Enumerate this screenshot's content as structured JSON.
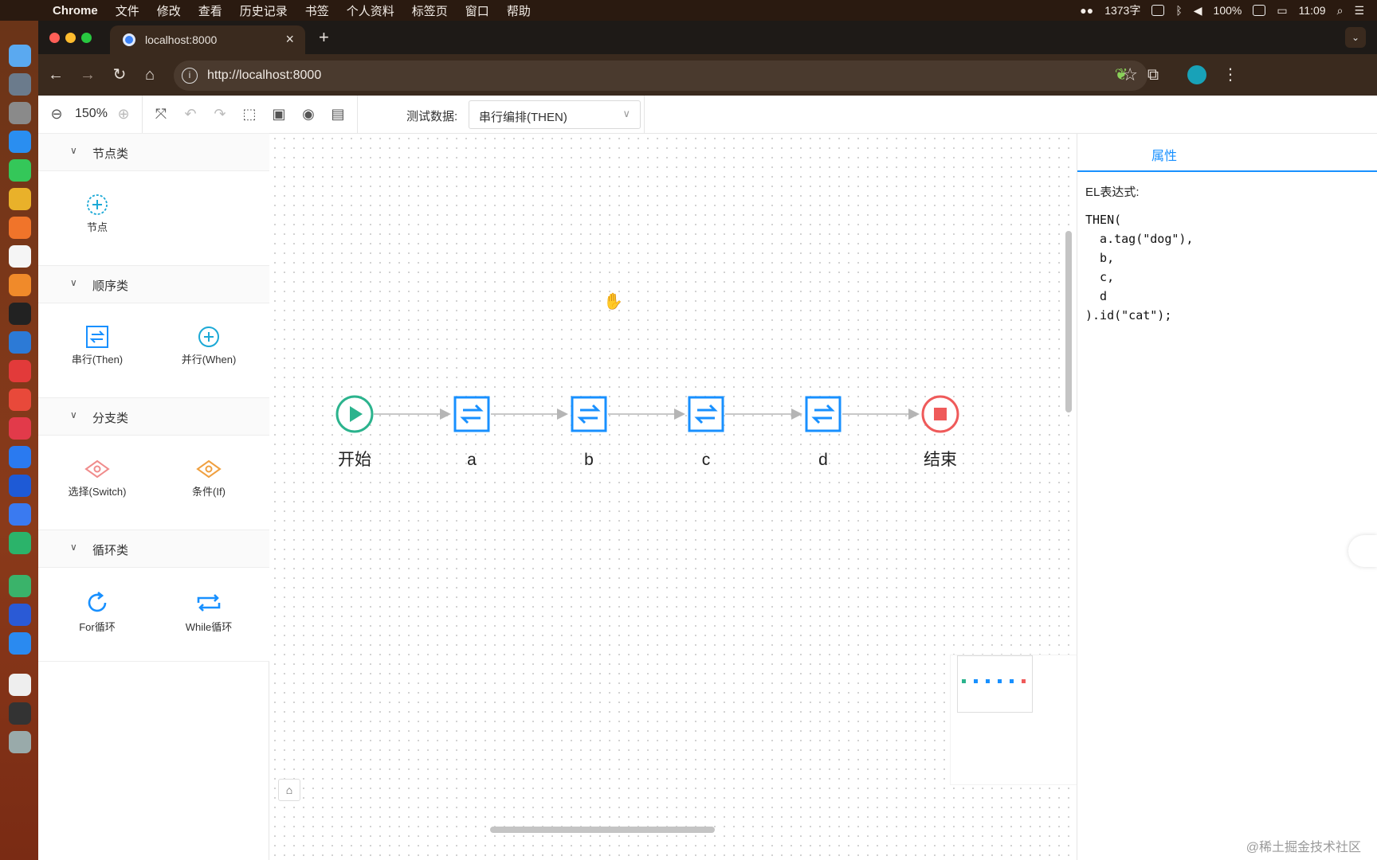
{
  "menubar": {
    "app_name": "Chrome",
    "menus": [
      "文件",
      "修改",
      "查看",
      "历史记录",
      "书签",
      "个人资料",
      "标签页",
      "窗口",
      "帮助"
    ],
    "status": {
      "word_count": "1373字",
      "battery": "100%",
      "time": "11:09"
    }
  },
  "browser": {
    "tab_title": "localhost:8000",
    "url": "http://localhost:8000"
  },
  "app_toolbar": {
    "zoom_level": "150%",
    "test_data_label": "测试数据:",
    "test_data_value": "串行编排(THEN)"
  },
  "palette": {
    "groups": [
      {
        "title": "节点类",
        "items": [
          {
            "label": "节点",
            "icon": "node-add-icon"
          }
        ]
      },
      {
        "title": "顺序类",
        "items": [
          {
            "label": "串行(Then)",
            "icon": "then-icon"
          },
          {
            "label": "并行(When)",
            "icon": "when-icon"
          }
        ]
      },
      {
        "title": "分支类",
        "items": [
          {
            "label": "选择(Switch)",
            "icon": "switch-icon"
          },
          {
            "label": "条件(If)",
            "icon": "if-icon"
          }
        ]
      },
      {
        "title": "循环类",
        "items": [
          {
            "label": "For循环",
            "icon": "for-loop-icon"
          },
          {
            "label": "While循环",
            "icon": "while-loop-icon"
          }
        ]
      }
    ]
  },
  "flow": {
    "nodes": [
      {
        "id": "start",
        "label": "开始",
        "type": "start"
      },
      {
        "id": "a",
        "label": "a",
        "type": "common"
      },
      {
        "id": "b",
        "label": "b",
        "type": "common"
      },
      {
        "id": "c",
        "label": "c",
        "type": "common"
      },
      {
        "id": "d",
        "label": "d",
        "type": "common"
      },
      {
        "id": "end",
        "label": "结束",
        "type": "end"
      }
    ]
  },
  "properties": {
    "tab_label": "属性",
    "el_label": "EL表达式:",
    "el_code": "THEN(\n  a.tag(\"dog\"),\n  b,\n  c,\n  d\n).id(\"cat\");"
  },
  "watermark": "@稀土掘金技术社区",
  "colors": {
    "accent": "#1890ff",
    "start": "#2bb38d",
    "end": "#ef5a5a",
    "node": "#1890ff",
    "switch": "#f08c8c",
    "if": "#f0a040"
  }
}
